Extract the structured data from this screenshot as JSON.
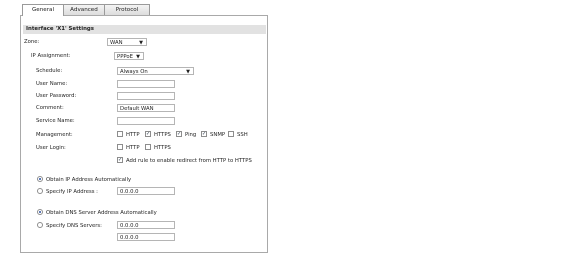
{
  "tabs": [
    {
      "label": "General",
      "active": true
    },
    {
      "label": "Advanced",
      "active": false
    },
    {
      "label": "Protocol",
      "active": false
    }
  ],
  "section": {
    "title": "Interface 'X1' Settings"
  },
  "zone": {
    "label": "Zone:",
    "value": "WAN"
  },
  "ip_assignment": {
    "label": "IP Assignment:",
    "value": "PPPoE"
  },
  "schedule": {
    "label": "Schedule:",
    "value": "Always On"
  },
  "user_name": {
    "label": "User Name:",
    "value": ""
  },
  "user_password": {
    "label": "User Password:",
    "value": ""
  },
  "comment": {
    "label": "Comment:",
    "value": "Default WAN"
  },
  "service_name": {
    "label": "Service Name:",
    "value": ""
  },
  "management": {
    "label": "Management:",
    "options": [
      {
        "label": "HTTP",
        "checked": false
      },
      {
        "label": "HTTPS",
        "checked": true
      },
      {
        "label": "Ping",
        "checked": true
      },
      {
        "label": "SNMP",
        "checked": true
      },
      {
        "label": "SSH",
        "checked": false
      }
    ]
  },
  "user_login": {
    "label": "User Login:",
    "options": [
      {
        "label": "HTTP",
        "checked": false
      },
      {
        "label": "HTTPS",
        "checked": false
      }
    ],
    "redirect_rule": {
      "label": "Add rule to enable redirect from HTTP to HTTPS",
      "checked": true
    }
  },
  "ip_address": {
    "obtain_label": "Obtain IP Address Automatically",
    "obtain_selected": true,
    "specify_label": "Specify IP Address :",
    "specify_selected": false,
    "value": "0.0.0.0"
  },
  "dns": {
    "obtain_label": "Obtain DNS Server Address Automatically",
    "obtain_selected": true,
    "specify_label": "Specify DNS Servers:",
    "specify_selected": false,
    "server1": "0.0.0.0",
    "server2": "0.0.0.0"
  }
}
